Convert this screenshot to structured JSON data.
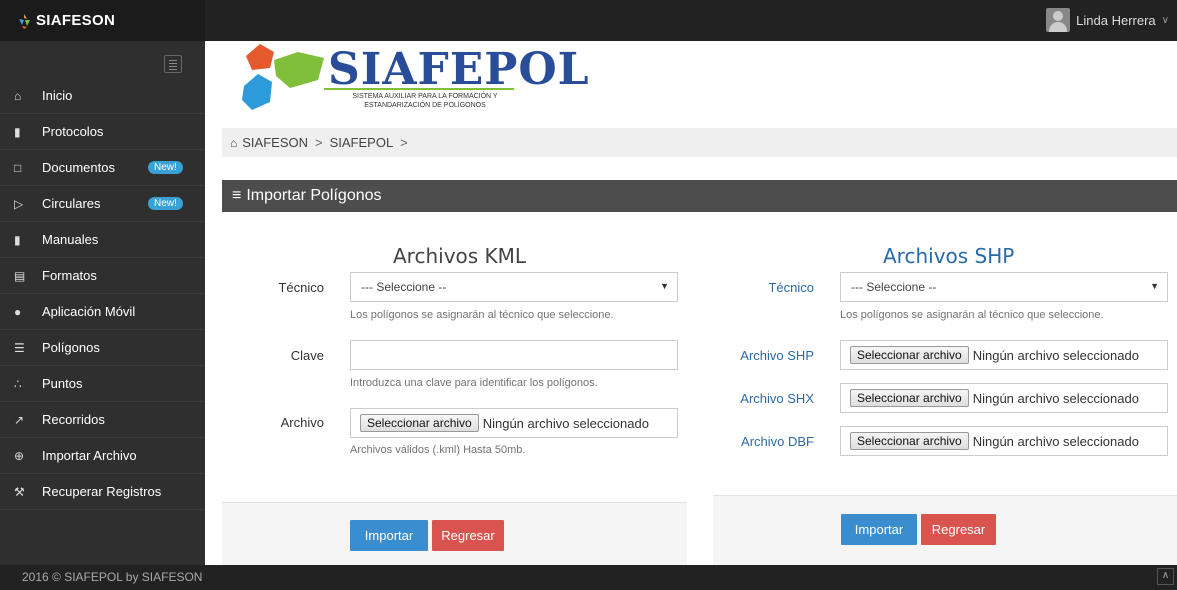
{
  "app": {
    "brand": "SIAFESON",
    "user_name": "Linda Herrera",
    "user_chevron": "∨"
  },
  "sidebar": {
    "items": [
      {
        "label": "Inicio",
        "icon": "⌂",
        "icon_name": "home-icon"
      },
      {
        "label": "Protocolos",
        "icon": "▮",
        "icon_name": "book-icon"
      },
      {
        "label": "Documentos",
        "icon": "□",
        "icon_name": "folder-icon",
        "badge": "New!"
      },
      {
        "label": "Circulares",
        "icon": "▷",
        "icon_name": "folder-open-icon",
        "badge": "New!"
      },
      {
        "label": "Manuales",
        "icon": "▮",
        "icon_name": "book-icon"
      },
      {
        "label": "Formatos",
        "icon": "▤",
        "icon_name": "file-icon"
      },
      {
        "label": "Aplicación Móvil",
        "icon": "●",
        "icon_name": "android-icon"
      },
      {
        "label": "Polígonos",
        "icon": "☰",
        "icon_name": "list-icon"
      },
      {
        "label": "Puntos",
        "icon": "∴",
        "icon_name": "spinner-icon"
      },
      {
        "label": "Recorridos",
        "icon": "↗",
        "icon_name": "route-icon"
      },
      {
        "label": "Importar Archivo",
        "icon": "⊕",
        "icon_name": "plus-circle-icon"
      },
      {
        "label": "Recuperar Registros",
        "icon": "⚒",
        "icon_name": "wrench-icon"
      }
    ]
  },
  "logo": {
    "title": "SIAFEPOL",
    "subtitle_line1": "SISTEMA AUXILIAR PARA LA FORMACIÓN Y",
    "subtitle_line2": "ESTANDARIZACIÓN DE POLÍGONOS"
  },
  "breadcrumb": {
    "home_icon": "⌂",
    "items": [
      "SIAFESON",
      "SIAFEPOL"
    ],
    "separator": ">"
  },
  "panel": {
    "icon": "≡",
    "title": "Importar Polígonos"
  },
  "kml": {
    "title": "Archivos KML",
    "tecnico_label": "Técnico",
    "tecnico_value": "--- Seleccione --",
    "tecnico_help": "Los polígonos se asignarán al técnico que seleccione.",
    "clave_label": "Clave",
    "clave_value": "",
    "clave_help": "Introduzca una clave para identificar los polígonos.",
    "archivo_label": "Archivo",
    "file_button": "Seleccionar archivo",
    "file_status": "Ningún archivo seleccionado",
    "archivo_help": "Archivos válidos (.kml) Hasta 50mb.",
    "import_button": "Importar",
    "back_button": "Regresar"
  },
  "shp": {
    "title": "Archivos SHP",
    "tecnico_label": "Técnico",
    "tecnico_value": "--- Seleccione --",
    "tecnico_help": "Los polígonos se asignarán al técnico que seleccione.",
    "shp_label": "Archivo SHP",
    "shx_label": "Archivo SHX",
    "dbf_label": "Archivo DBF",
    "file_button": "Seleccionar archivo",
    "file_status": "Ningún archivo seleccionado",
    "import_button": "Importar",
    "back_button": "Regresar"
  },
  "footer": {
    "text": "2016 © SIAFEPOL by SIAFESON",
    "scroll_icon": "∧"
  },
  "colors": {
    "primary": "#3a8ed0",
    "danger": "#d9534f",
    "brand_blue": "#2a4d9a",
    "sidebar": "#2f2f2f",
    "panel_header": "#4d4d4d"
  }
}
